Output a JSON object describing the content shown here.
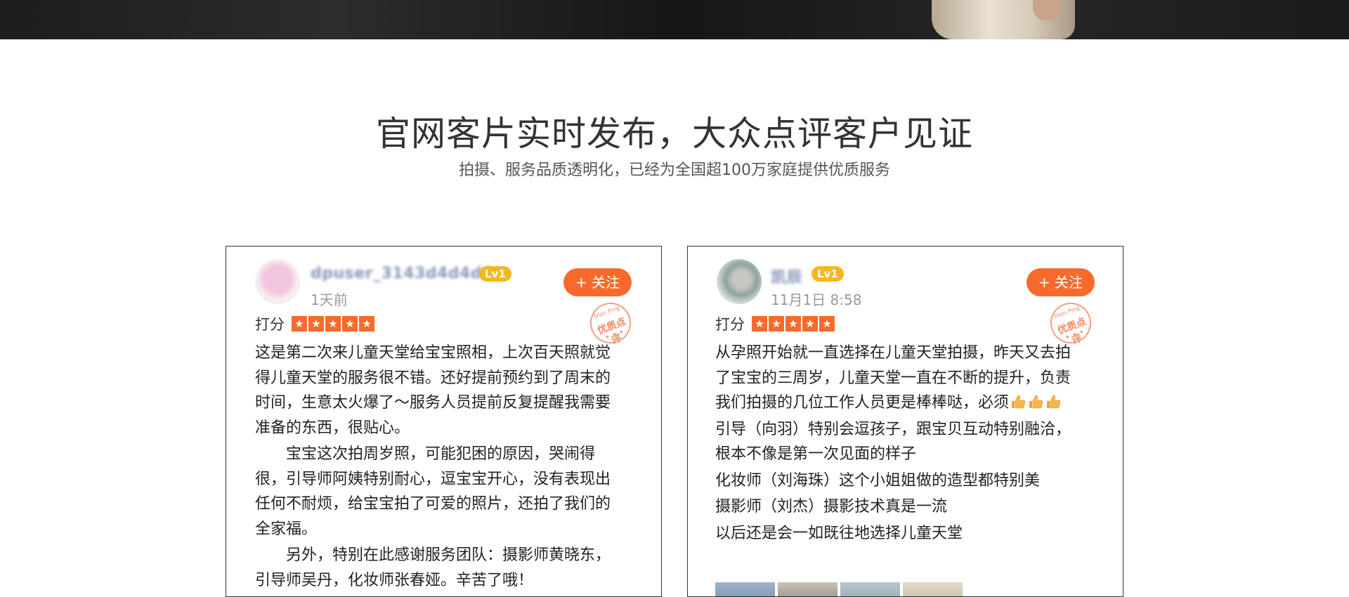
{
  "section": {
    "title": "官网客片实时发布，大众点评客户见证",
    "subtitle": "拍摄、服务品质透明化，已经为全国超100万家庭提供优质服务"
  },
  "reviews": [
    {
      "username": "dpuser_3143d4d4d6",
      "level": "Lv1",
      "time": "1天前",
      "follow_label": "+ 关注",
      "stamp_text": "优质点评",
      "stamp_top": "Dian Ping",
      "rating_label": "打分",
      "stars": 5,
      "paragraphs": [
        "这是第二次来儿童天堂给宝宝照相，上次百天照就觉得儿童天堂的服务很不错。还好提前预约到了周末的时间，生意太火爆了～服务人员提前反复提醒我需要准备的东西，很贴心。",
        "宝宝这次拍周岁照，可能犯困的原因，哭闹得很，引导师阿姨特别耐心，逗宝宝开心，没有表现出任何不耐烦，给宝宝拍了可爱的照片，还拍了我们的全家福。",
        "另外，特别在此感谢服务团队：摄影师黄晓东，引导师吴丹，化妆师张春娅。辛苦了哦！"
      ]
    },
    {
      "username": "凯辰",
      "level": "Lv1",
      "time": "11月1日  8:58",
      "follow_label": "+ 关注",
      "stamp_text": "优质点评",
      "stamp_top": "Dian Ping",
      "rating_label": "打分",
      "stars": 5,
      "paragraphs": [
        "从孕照开始就一直选择在儿童天堂拍摄，昨天又去拍了宝宝的三周岁，儿童天堂一直在不断的提升，负责我们拍摄的几位工作人员更是棒棒哒，必须",
        "引导（向羽）特别会逗孩子，跟宝贝互动特别融洽，根本不像是第一次见面的样子",
        "化妆师（刘海珠）这个小姐姐做的造型都特别美",
        "摄影师（刘杰）摄影技术真是一流",
        "以后还是会一如既往地选择儿童天堂"
      ]
    }
  ],
  "icons": {
    "star": "star-icon",
    "thumbs": "thumbs-up-icon"
  },
  "colors": {
    "accent": "#f86a2c",
    "level_badge": "#f6b81e",
    "stamp": "#f08a63"
  }
}
